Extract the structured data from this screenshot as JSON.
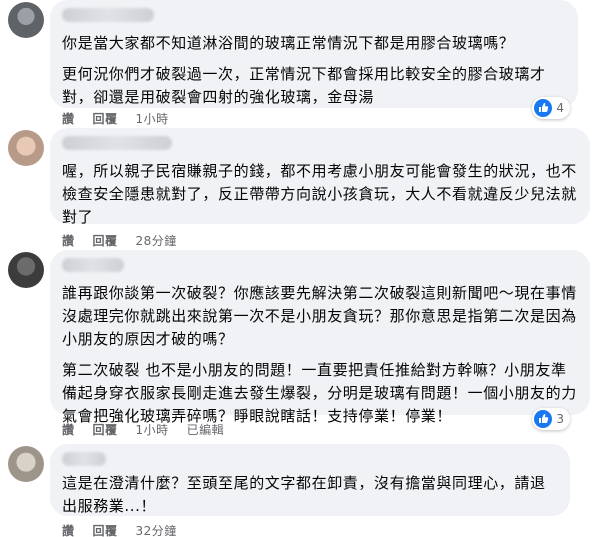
{
  "comments": [
    {
      "paragraphs": [
        "你是當大家都不知道淋浴間的玻璃正常情況下都是用膠合玻璃嗎？",
        "更何況你們才破裂過一次，正常情況下都會採用比較安全的膠合玻璃才對，卻還是用破裂會四射的強化玻璃，金母湯"
      ],
      "actions": {
        "like": "讚",
        "reply": "回覆",
        "time": "1小時"
      },
      "reaction_count": "4"
    },
    {
      "paragraphs": [
        "喔，所以親子民宿賺親子的錢，都不用考慮小朋友可能會發生的狀況，也不檢查安全隱患就對了，反正帶帶方向說小孩貪玩，大人不看就違反少兒法就對了"
      ],
      "actions": {
        "like": "讚",
        "reply": "回覆",
        "time": "28分鐘"
      }
    },
    {
      "paragraphs": [
        "誰再跟你談第一次破裂？你應該要先解決第二次破裂這則新聞吧～現在事情沒處理完你就跳出來說第一次不是小朋友貪玩？那你意思是指第二次是因為小朋友的原因才破的嗎？",
        "第二次破裂 也不是小朋友的問題！一直要把責任推給對方幹嘛？小朋友準備起身穿衣服家長剛走進去發生爆裂，分明是玻璃有問題！一個小朋友的力氣會把強化玻璃弄碎嗎？睜眼說瞎話！支持停業！停業！"
      ],
      "actions": {
        "like": "讚",
        "reply": "回覆",
        "time": "1小時",
        "edited": "已編輯"
      },
      "reaction_count": "3"
    },
    {
      "paragraphs": [
        "這是在澄清什麼？至頭至尾的文字都在卸責，沒有擔當與同理心，請退出服務業...！"
      ],
      "actions": {
        "like": "讚",
        "reply": "回覆",
        "time": "32分鐘"
      }
    }
  ],
  "colors": {
    "bubble": "#f0f2f5",
    "meta": "#65676b",
    "like_blue": "#1877f2"
  },
  "icons": {
    "reaction": "like-thumb-icon"
  }
}
